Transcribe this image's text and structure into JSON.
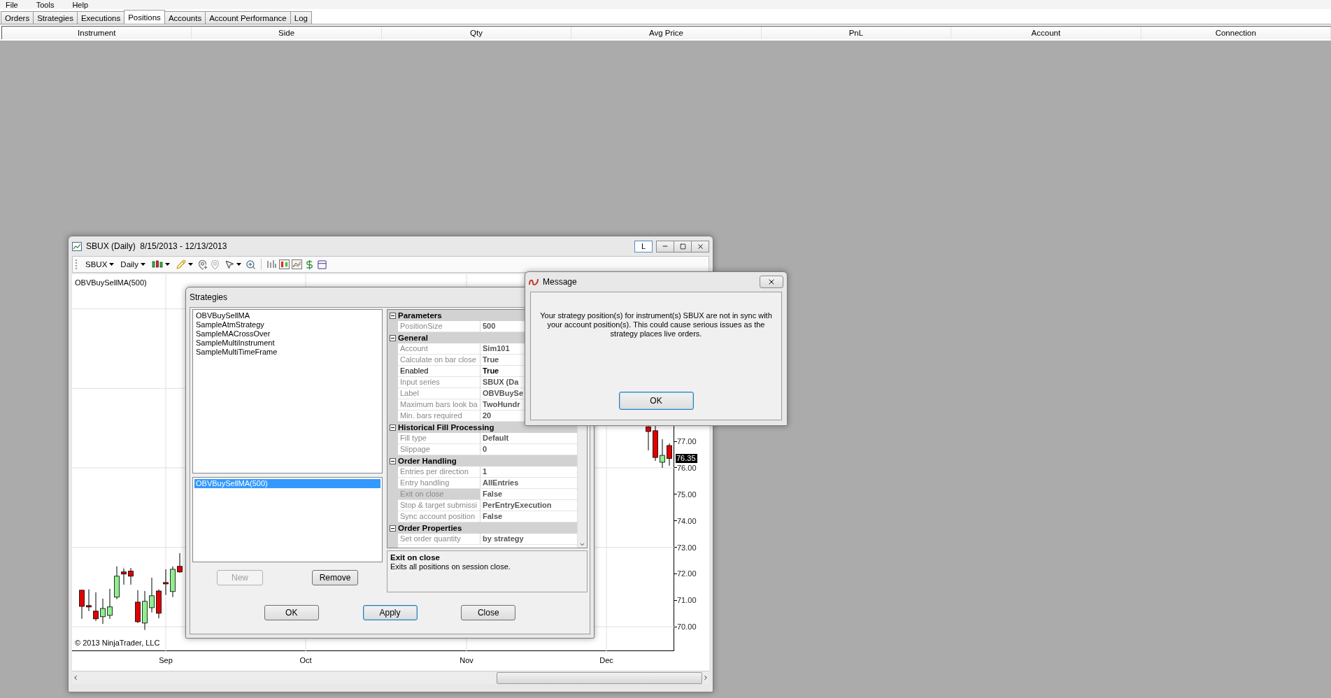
{
  "menu": [
    "File",
    "Tools",
    "Help"
  ],
  "tabs": [
    {
      "label": "Orders",
      "selected": false
    },
    {
      "label": "Strategies",
      "selected": false
    },
    {
      "label": "Executions",
      "selected": false
    },
    {
      "label": "Positions",
      "selected": true
    },
    {
      "label": "Accounts",
      "selected": false
    },
    {
      "label": "Account Performance",
      "selected": false
    },
    {
      "label": "Log",
      "selected": false
    }
  ],
  "positions_table": {
    "columns": [
      "Instrument",
      "Side",
      "Qty",
      "Avg Price",
      "PnL",
      "Account",
      "Connection"
    ]
  },
  "chart_window": {
    "title": "SBUX (Daily)  8/15/2013 - 12/13/2013",
    "layout_button": "L",
    "instrument": "SBUX",
    "interval": "Daily",
    "indicator_label": "OBVBuySellMA(500)",
    "copyright": "© 2013 NinjaTrader, LLC",
    "last_price": "76.35",
    "chart_data": {
      "type": "candlestick",
      "yticks": [
        {
          "value": 77,
          "label": "77.00"
        },
        {
          "value": 76,
          "label": "76.00"
        },
        {
          "value": 75,
          "label": "75.00"
        },
        {
          "value": 74,
          "label": "74.00"
        },
        {
          "value": 73,
          "label": "73.00"
        },
        {
          "value": 72,
          "label": "72.00"
        },
        {
          "value": 71,
          "label": "71.00"
        },
        {
          "value": 70,
          "label": "70.00"
        }
      ],
      "grid": true,
      "ylim": [
        69.08,
        83.31
      ],
      "categories": [
        null,
        null,
        null,
        null,
        null,
        null,
        null,
        null,
        null,
        null,
        null,
        null,
        "Sep",
        null,
        null,
        null,
        null,
        null,
        null,
        null,
        null,
        null,
        null,
        null,
        null,
        null,
        null,
        null,
        null,
        null,
        null,
        null,
        "Oct",
        null,
        null,
        null,
        null,
        null,
        null,
        null,
        null,
        null,
        null,
        null,
        null,
        null,
        null,
        null,
        null,
        null,
        null,
        null,
        null,
        null,
        null,
        "Nov",
        null,
        null,
        null,
        null,
        null,
        null,
        null,
        null,
        null,
        null,
        null,
        null,
        null,
        null,
        null,
        null,
        null,
        null,
        null,
        "Dec",
        null,
        null,
        null,
        null,
        null,
        null,
        null,
        null,
        null
      ],
      "ohlc": [
        [
          71.38,
          71.38,
          70.3,
          70.77
        ],
        [
          70.8,
          71.41,
          70.59,
          70.75
        ],
        [
          70.59,
          71.3,
          70.22,
          70.3
        ],
        [
          70.38,
          71.06,
          70.11,
          70.69
        ],
        [
          70.43,
          71.43,
          70.3,
          70.75
        ],
        [
          71.12,
          72.28,
          71.04,
          71.91
        ],
        [
          72.07,
          72.2,
          71.59,
          71.99
        ],
        [
          72.1,
          72.22,
          71.59,
          71.91
        ],
        [
          70.93,
          71.38,
          70.14,
          70.19
        ],
        [
          70.14,
          71.35,
          69.88,
          70.96
        ],
        [
          70.72,
          71.85,
          70.54,
          71.17
        ],
        [
          71.35,
          71.41,
          70.32,
          70.51
        ],
        [
          71.67,
          72.17,
          71.2,
          71.62
        ],
        [
          71.33,
          72.28,
          71.12,
          72.17
        ],
        [
          72.28,
          72.78,
          72.04,
          72.07
        ],
        null,
        null,
        null,
        null,
        null,
        null,
        null,
        null,
        null,
        null,
        null,
        null,
        null,
        null,
        null,
        null,
        null,
        null,
        null,
        null,
        null,
        null,
        null,
        null,
        null,
        null,
        null,
        null,
        null,
        null,
        null,
        null,
        null,
        null,
        null,
        null,
        null,
        null,
        null,
        null,
        null,
        null,
        null,
        null,
        null,
        null,
        null,
        null,
        null,
        null,
        null,
        null,
        null,
        null,
        null,
        null,
        null,
        null,
        null,
        null,
        null,
        null,
        null,
        null,
        null,
        null,
        [
          77.55,
          77.57,
          76.66,
          77.37
        ],
        [
          77.4,
          77.58,
          76.26,
          76.39
        ],
        [
          76.21,
          77.08,
          76.0,
          76.47
        ],
        [
          76.84,
          76.92,
          76.08,
          76.35
        ]
      ]
    }
  },
  "strategies_dialog": {
    "title": "Strategies",
    "available": [
      {
        "label": "OBVBuySellMA",
        "selected": false
      },
      {
        "label": "SampleAtmStrategy",
        "selected": false
      },
      {
        "label": "SampleMACrossOver",
        "selected": false
      },
      {
        "label": "SampleMultiInstrument",
        "selected": false
      },
      {
        "label": "SampleMultiTimeFrame",
        "selected": false
      }
    ],
    "active": [
      {
        "label": "OBVBuySellMA(500)",
        "selected": true
      }
    ],
    "new_button": {
      "label": "New",
      "disabled": true
    },
    "remove_button": {
      "label": "Remove",
      "disabled": false
    },
    "properties": [
      {
        "category": "Parameters",
        "expanded": true,
        "rows": [
          {
            "name": "PositionSize",
            "value": "500",
            "disabled": true,
            "selected": false
          }
        ]
      },
      {
        "category": "General",
        "expanded": true,
        "rows": [
          {
            "name": "Account",
            "value": "Sim101",
            "disabled": true,
            "selected": false
          },
          {
            "name": "Calculate on bar close",
            "value": "True",
            "disabled": true,
            "selected": false
          },
          {
            "name": "Enabled",
            "value": "True",
            "disabled": false,
            "selected": false
          },
          {
            "name": "Input series",
            "value": "SBUX (Da",
            "disabled": true,
            "selected": false
          },
          {
            "name": "Label",
            "value": "OBVBuySe",
            "disabled": true,
            "selected": false
          },
          {
            "name": "Maximum bars look ba",
            "value": "TwoHundr",
            "disabled": true,
            "selected": false
          },
          {
            "name": "Min. bars required",
            "value": "20",
            "disabled": true,
            "selected": false
          }
        ]
      },
      {
        "category": "Historical Fill Processing",
        "expanded": true,
        "rows": [
          {
            "name": "Fill type",
            "value": "Default",
            "disabled": true,
            "selected": false
          },
          {
            "name": "Slippage",
            "value": "0",
            "disabled": true,
            "selected": false
          }
        ]
      },
      {
        "category": "Order Handling",
        "expanded": true,
        "rows": [
          {
            "name": "Entries per direction",
            "value": "1",
            "disabled": true,
            "selected": false
          },
          {
            "name": "Entry handling",
            "value": "AllEntries",
            "disabled": true,
            "selected": false
          },
          {
            "name": "Exit on close",
            "value": "False",
            "disabled": true,
            "selected": true
          },
          {
            "name": "Stop & target submissi",
            "value": "PerEntryExecution",
            "disabled": true,
            "selected": false
          },
          {
            "name": "Sync account position",
            "value": "False",
            "disabled": true,
            "selected": false
          }
        ]
      },
      {
        "category": "Order Properties",
        "expanded": true,
        "rows": [
          {
            "name": "Set order quantity",
            "value": "by strategy",
            "disabled": true,
            "selected": false
          }
        ]
      }
    ],
    "description": {
      "title": "Exit on close",
      "text": "Exits all positions on session close."
    },
    "buttons": [
      {
        "label": "OK",
        "focused": false
      },
      {
        "label": "Apply",
        "focused": true
      },
      {
        "label": "Close",
        "focused": false
      }
    ]
  },
  "message_dialog": {
    "title": "Message",
    "text": "Your strategy position(s) for instrument(s) SBUX are not in sync with your account position(s). This could cause serious issues as the strategy places live orders.",
    "button": {
      "label": "OK",
      "focused": true
    }
  }
}
